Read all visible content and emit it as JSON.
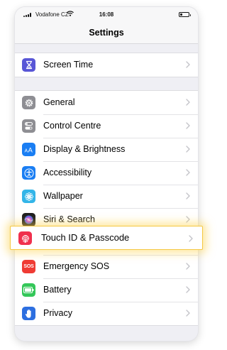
{
  "status_bar": {
    "carrier": "Vodafone CZ",
    "time": "16:08"
  },
  "nav": {
    "title": "Settings"
  },
  "groups": [
    {
      "items": [
        {
          "label": "Screen Time",
          "icon": "hourglass-icon",
          "color": "#5856d6"
        }
      ]
    },
    {
      "items": [
        {
          "label": "General",
          "icon": "gear-icon",
          "color": "#8e8e93"
        },
        {
          "label": "Control Centre",
          "icon": "toggles-icon",
          "color": "#8e8e93"
        },
        {
          "label": "Display & Brightness",
          "icon": "text-size-icon",
          "color": "#1a7ef3"
        },
        {
          "label": "Accessibility",
          "icon": "accessibility-icon",
          "color": "#1a7ef3"
        },
        {
          "label": "Wallpaper",
          "icon": "flower-icon",
          "color": "#33b5e8"
        },
        {
          "label": "Siri & Search",
          "icon": "siri-icon",
          "color": "#1c1c1e"
        },
        {
          "label": "Touch ID & Passcode",
          "icon": "fingerprint-icon",
          "color": "#f0304d",
          "highlighted": true
        },
        {
          "label": "Emergency SOS",
          "icon": "sos-icon",
          "color": "#ef3b34",
          "icon_text": "SOS"
        },
        {
          "label": "Battery",
          "icon": "battery-icon",
          "color": "#34c759"
        },
        {
          "label": "Privacy",
          "icon": "hand-icon",
          "color": "#2d6fe0"
        }
      ]
    }
  ],
  "highlight_color": "#f5c842"
}
